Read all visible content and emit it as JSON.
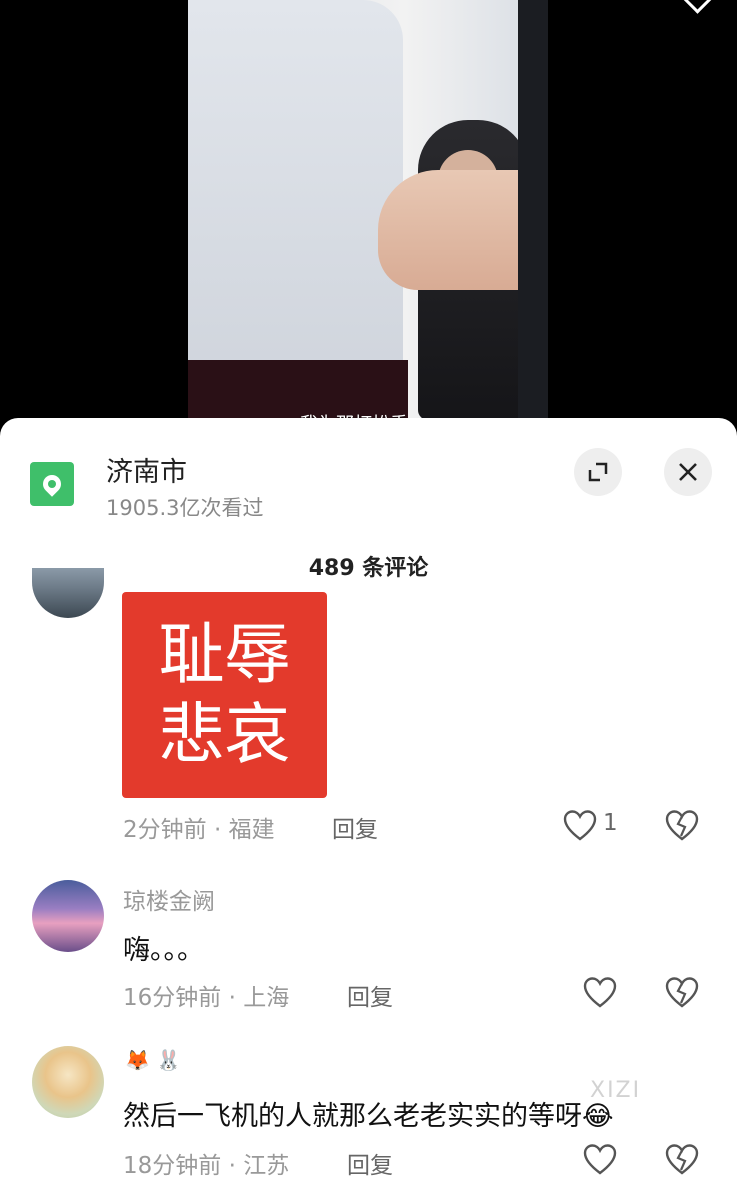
{
  "video": {
    "caption": "我为那打扮乘"
  },
  "header": {
    "location_name": "济南市",
    "views": "1905.3亿次看过",
    "comment_count": "489 条评论"
  },
  "comments": [
    {
      "image_text_line1": "耻辱",
      "image_text_line2": "悲哀",
      "time_location": "2分钟前 · 福建",
      "reply_label": "回复",
      "likes": "1"
    },
    {
      "username": "琼楼金阙",
      "text": "嗨。。。",
      "time_location": "16分钟前 · 上海",
      "reply_label": "回复"
    },
    {
      "username_emojis": "🦊 🐰",
      "text": "然后一飞机的人就那么老老实实的等呀",
      "text_emoji": "😂",
      "time_location": "18分钟前 · 江苏",
      "reply_label": "回复"
    }
  ],
  "watermark": "XIZI",
  "colors": {
    "location_icon_bg": "#3fbf6a",
    "meme_bg": "#e33a2c"
  }
}
